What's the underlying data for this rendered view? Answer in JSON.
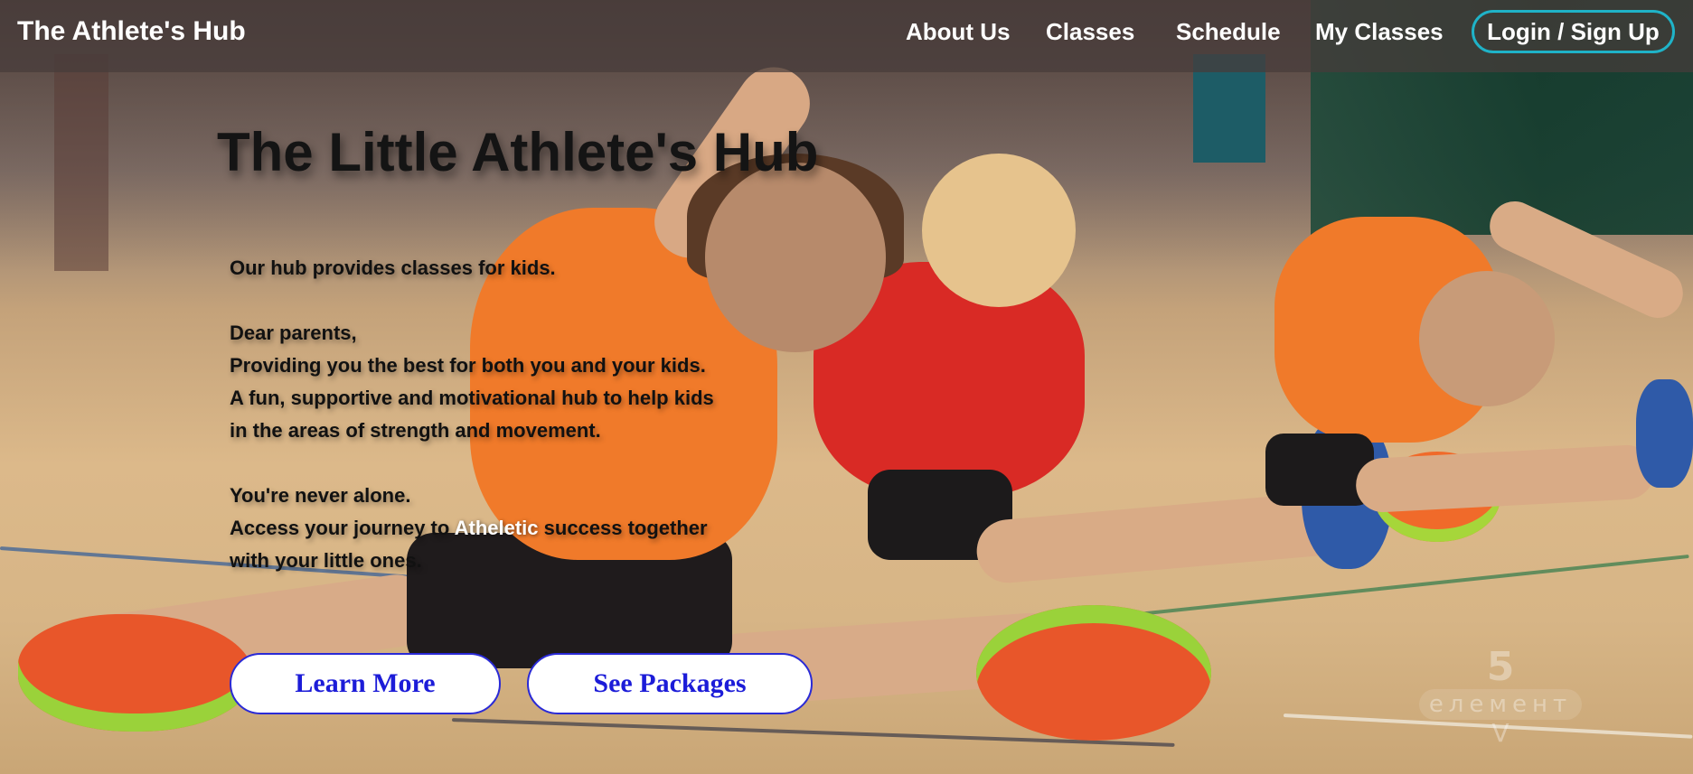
{
  "navbar": {
    "brand": "The Athlete's Hub",
    "links": {
      "about": "About Us",
      "classes": "Classes",
      "schedule": "Schedule",
      "my_classes": "My Classes"
    },
    "login_label": "Login / Sign Up"
  },
  "hero": {
    "title": "The Little Athlete's Hub",
    "paragraph_1": "Our hub provides classes for kids.",
    "paragraph_2": [
      "Dear parents,",
      "Providing you the best for both you and your kids.",
      "A fun, supportive and motivational hub to help kids",
      "in the areas of strength and movement."
    ],
    "paragraph_3": {
      "line_1": "You're never alone.",
      "line_2_before": "Access your journey to ",
      "line_2_highlight": "Atheletic",
      "line_2_after": " success together",
      "line_3": "with your little ones."
    },
    "buttons": {
      "learn_more": "Learn More",
      "see_packages": "See Packages"
    }
  },
  "watermark": {
    "number": "5",
    "word": "елемент",
    "letter": "V"
  },
  "colors": {
    "navbar_bg": "#463a3a",
    "login_border": "#1fb3c8",
    "button_text": "#1c1cd8",
    "button_border": "#2a2ad6",
    "highlight_text": "#ffffff"
  }
}
